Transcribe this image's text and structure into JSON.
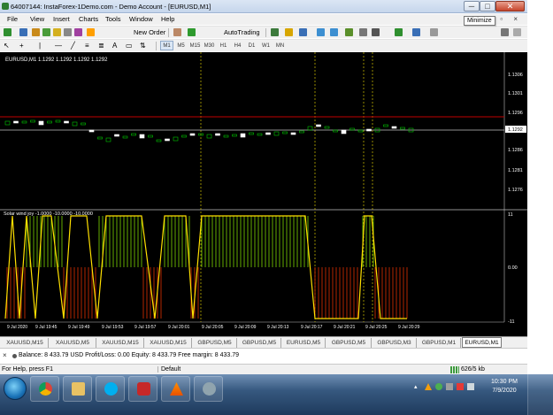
{
  "window": {
    "title": "64007144: InstaForex-1Demo.com - Demo Account - [EURUSD,M1]",
    "minimize_tooltip": "Minimize",
    "buttons": {
      "minimize": "─",
      "maximize": "□",
      "close": "✕"
    }
  },
  "menu": {
    "items": [
      "File",
      "View",
      "Insert",
      "Charts",
      "Tools",
      "Window",
      "Help"
    ],
    "mdi_controls": "– ▫ ×"
  },
  "toolbar": {
    "new_order": "New Order",
    "autotrading": "AutoTrading",
    "text_tool": "A",
    "timeframes": [
      "M1",
      "M5",
      "M15",
      "M30",
      "H1",
      "H4",
      "D1",
      "W1",
      "MN"
    ],
    "active_timeframe": "M1"
  },
  "chart": {
    "symbol_header": "EURUSD,M1  1.1292 1.1292 1.1292 1.1292",
    "price_ticks": [
      "1.1306",
      "1.1301",
      "1.1296",
      "1.1292",
      "1.1286",
      "1.1281",
      "1.1276"
    ],
    "current_price": "1.1292",
    "indicator_label": "Solar wind joy  -1.0000 -10.0000 -10.0000",
    "indicator_ticks": [
      "11",
      "0.00",
      "-11"
    ],
    "time_labels": [
      "9 Jul 2020",
      "9 Jul 19:45",
      "9 Jul 19:49",
      "9 Jul 19:53",
      "9 Jul 19:57",
      "9 Jul 20:01",
      "9 Jul 20:05",
      "9 Jul 20:09",
      "9 Jul 20:13",
      "9 Jul 20:17",
      "9 Jul 20:21",
      "9 Jul 20:25",
      "9 Jul 20:29"
    ],
    "colors": {
      "background": "#000000",
      "bull_candle": "#00c800",
      "bear_candle": "#ffffff",
      "resistance_line": "#c00000",
      "bid_line": "#c0c0c0",
      "period_separator": "#d4c400",
      "indicator_up": "#7fd800",
      "indicator_down": "#e03000",
      "indicator_line": "#ffe000"
    }
  },
  "symbol_tabs": {
    "items": [
      "XAUUSD,M15",
      "XAUUSD,M5",
      "XAUUSD,M15",
      "XAUUSD,M15",
      "GBPUSD,M5",
      "GBPUSD,M5",
      "EURUSD,M5",
      "GBPUSD,M5",
      "GBPUSD,M3",
      "GBPUSD,M1",
      "EURUSD,M1"
    ],
    "active": "EURUSD,M1"
  },
  "terminal": {
    "close": "×",
    "balance": "Balance: 8 433.79 USD  Profit/Loss: 0.00  Equity: 8 433.79  Free margin: 8 433.79"
  },
  "statusbar": {
    "help": "For Help, press F1",
    "profile": "Default",
    "connection": "626/5 kb"
  },
  "taskbar": {
    "time": "10:30 PM",
    "date": "7/9/2020"
  }
}
